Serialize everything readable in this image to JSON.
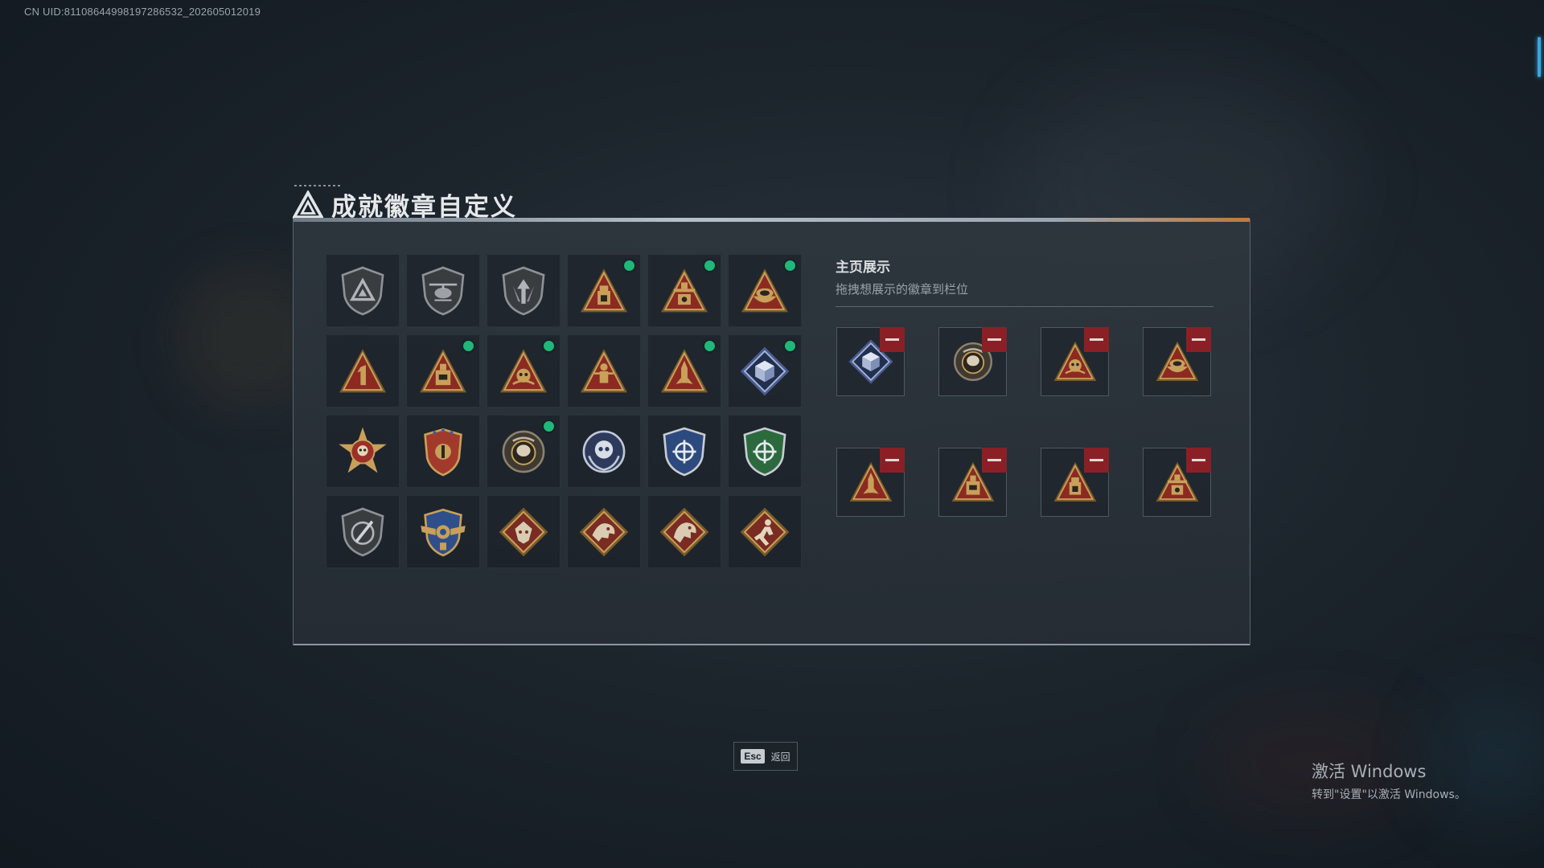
{
  "uid_text": "CN UID:8110864499819728653​2_202605012019",
  "title": "成就徽章自定义",
  "showcase": {
    "title": "主页展示",
    "subtitle": "拖拽想展示的徽章到栏位"
  },
  "badges": [
    {
      "icon": "shield-delta-badge",
      "new": false
    },
    {
      "icon": "helicopter-shield-badge",
      "new": false
    },
    {
      "icon": "arrow-shield-badge",
      "new": false
    },
    {
      "icon": "triangle-lantern-badge",
      "new": true
    },
    {
      "icon": "triangle-tower-badge",
      "new": true
    },
    {
      "icon": "triangle-bowl-badge",
      "new": true
    },
    {
      "icon": "triangle-number-one-badge",
      "new": false
    },
    {
      "icon": "triangle-box-badge",
      "new": true
    },
    {
      "icon": "triangle-skull-badge",
      "new": true
    },
    {
      "icon": "triangle-soldier-badge",
      "new": false
    },
    {
      "icon": "triangle-missile-badge",
      "new": true
    },
    {
      "icon": "diamond-cube-badge",
      "new": true
    },
    {
      "icon": "star-skull-medal-badge",
      "new": false
    },
    {
      "icon": "crest-shield-badge",
      "new": false
    },
    {
      "icon": "round-disc-badge",
      "new": true
    },
    {
      "icon": "round-skull-laurel-badge",
      "new": false
    },
    {
      "icon": "blue-crosshair-shield-badge",
      "new": false
    },
    {
      "icon": "green-crosshair-shield-badge",
      "new": false
    },
    {
      "icon": "knife-shield-badge",
      "new": false
    },
    {
      "icon": "winged-gear-shield-badge",
      "new": false
    },
    {
      "icon": "diamond-beast-badge",
      "new": false
    },
    {
      "icon": "diamond-dragon-badge",
      "new": false
    },
    {
      "icon": "diamond-dragon-alt-badge",
      "new": false
    },
    {
      "icon": "diamond-runner-badge",
      "new": false
    }
  ],
  "showcase_slots": [
    {
      "icon": "diamond-cube-badge"
    },
    {
      "icon": "round-disc-badge"
    },
    {
      "icon": "triangle-skull-badge"
    },
    {
      "icon": "triangle-bowl-badge"
    },
    {
      "icon": "triangle-missile-badge"
    },
    {
      "icon": "triangle-box-badge"
    },
    {
      "icon": "triangle-lantern-badge"
    },
    {
      "icon": "triangle-tower-badge"
    }
  ],
  "esc": {
    "key": "Esc",
    "label": "返回"
  },
  "watermark": {
    "title": "激活 Windows",
    "subtitle": "转到\"设置\"以激活 Windows。"
  },
  "colors": {
    "accent_new": "#1fb87a",
    "remove": "#8a2026",
    "gold": "#c8a05a",
    "red": "#8c2a22",
    "blue": "#2f4f8a",
    "green": "#2c6a3e"
  }
}
